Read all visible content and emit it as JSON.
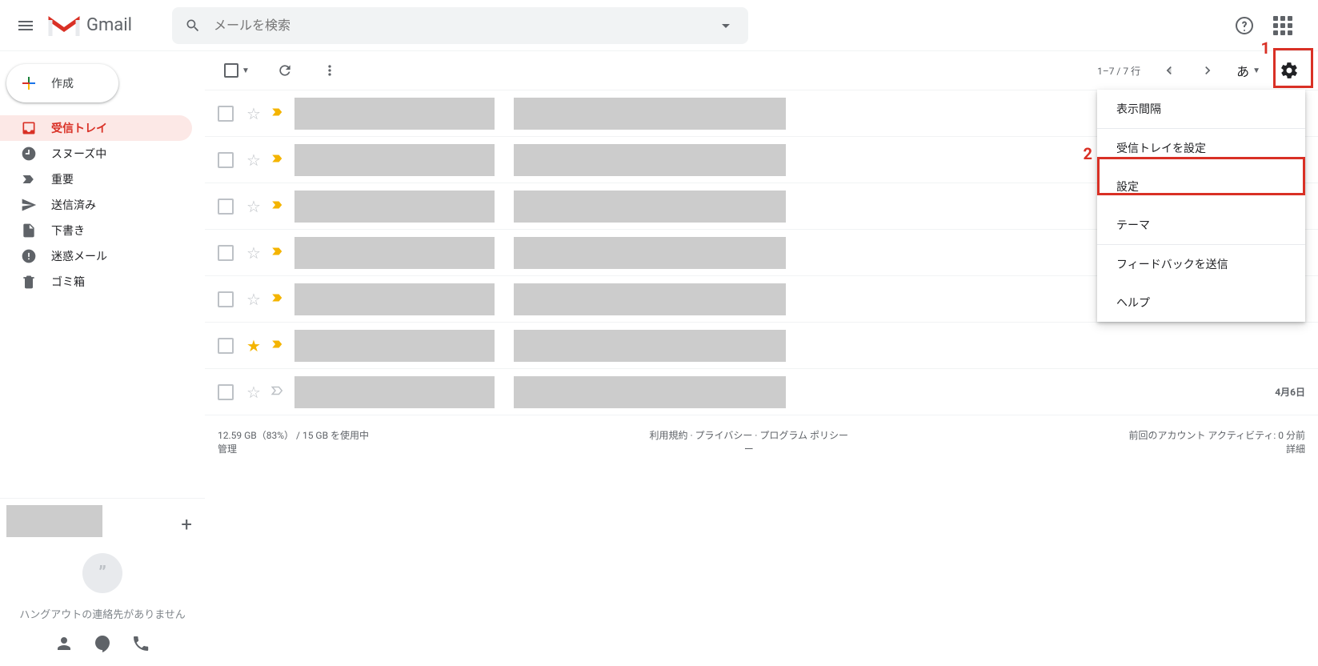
{
  "header": {
    "logo_text": "Gmail",
    "search_placeholder": "メールを検索"
  },
  "compose": {
    "label": "作成"
  },
  "sidebar": {
    "items": [
      {
        "label": "受信トレイ",
        "icon": "inbox",
        "active": true
      },
      {
        "label": "スヌーズ中",
        "icon": "clock"
      },
      {
        "label": "重要",
        "icon": "important"
      },
      {
        "label": "送信済み",
        "icon": "sent"
      },
      {
        "label": "下書き",
        "icon": "draft"
      },
      {
        "label": "迷惑メール",
        "icon": "spam"
      },
      {
        "label": "ゴミ箱",
        "icon": "trash"
      }
    ]
  },
  "hangouts": {
    "no_contacts": "ハングアウトの連絡先がありません"
  },
  "toolbar": {
    "page_info": "1–7 / 7 行",
    "lang": "あ"
  },
  "emails": [
    {
      "starred": false,
      "important": true,
      "date": ""
    },
    {
      "starred": false,
      "important": true,
      "date": ""
    },
    {
      "starred": false,
      "important": true,
      "date": ""
    },
    {
      "starred": false,
      "important": true,
      "date": ""
    },
    {
      "starred": false,
      "important": true,
      "date": ""
    },
    {
      "starred": true,
      "important": true,
      "date": ""
    },
    {
      "starred": false,
      "important": false,
      "date": "4月6日"
    }
  ],
  "settings_menu": {
    "items": [
      "表示間隔",
      "受信トレイを設定",
      "設定",
      "テーマ",
      "フィードバックを送信",
      "ヘルプ"
    ]
  },
  "callouts": {
    "c1": "1",
    "c2": "2"
  },
  "footer": {
    "storage_line1": "12.59 GB（83%） / 15 GB を使用中",
    "storage_line2": "管理",
    "policy": "利用規約 · プライバシー · プログラム ポリシー",
    "activity_line1": "前回のアカウント アクティビティ: 0 分前",
    "activity_line2": "詳細"
  }
}
